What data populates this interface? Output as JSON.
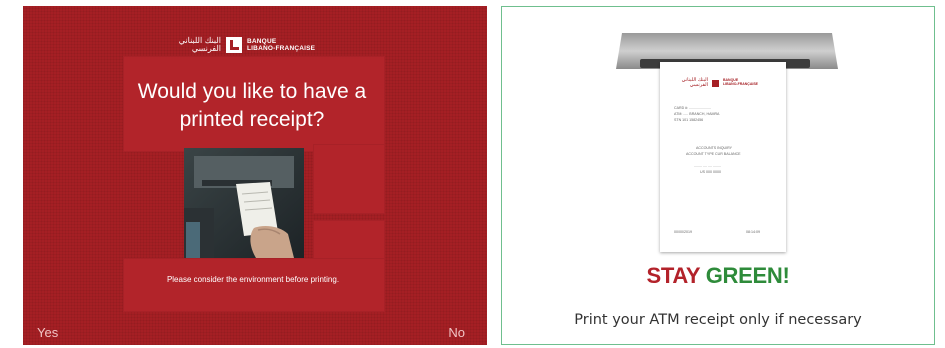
{
  "atm": {
    "brand": {
      "arabic": "البنك اللبناني الفرنسي",
      "line1": "BANQUE",
      "line2": "LIBANO-FRANÇAISE"
    },
    "question": "Would you like to have a printed receipt?",
    "note": "Please consider the environment before printing.",
    "options": {
      "yes": "Yes",
      "no": "No"
    }
  },
  "poster": {
    "receipt": {
      "brand_arabic": "البنك اللبناني الفرنسي",
      "brand_line1": "BANQUE",
      "brand_line2": "LIBANO-FRANÇAISE",
      "lines": [
        "CARD #: ......................",
        "ATM: ..... BRANCH, HAMRA",
        "STN 101 1582456",
        "ACCOUNTS INQUIRY",
        "ACCOUNT TYPE CUR BALANCE",
        "........  ....  ....  ........",
        "US 000 0000",
        "00/00/2019",
        "08:14:09"
      ]
    },
    "headline_word1": "STAY",
    "headline_word2": "GREEN!",
    "message": "Print your ATM receipt only if necessary"
  },
  "colors": {
    "brand_red": "#a51f24",
    "green": "#2e8b3a"
  }
}
